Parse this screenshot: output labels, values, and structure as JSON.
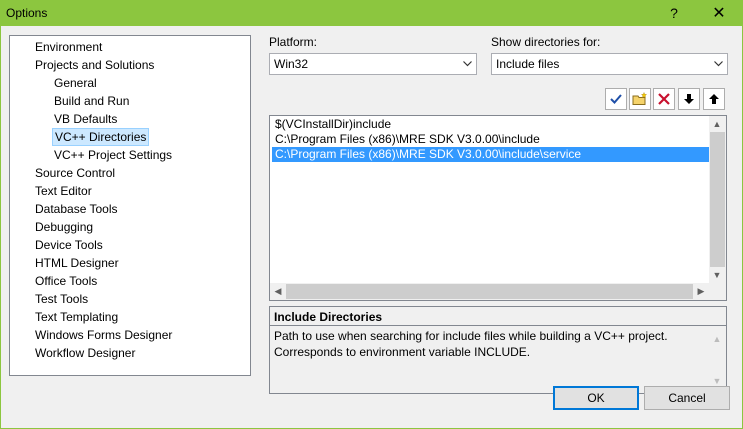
{
  "window": {
    "title": "Options",
    "help_glyph": "?",
    "close_glyph": "✕"
  },
  "tree": {
    "items": [
      {
        "label": "Environment",
        "indent": 0
      },
      {
        "label": "Projects and Solutions",
        "indent": 0
      },
      {
        "label": "General",
        "indent": 1
      },
      {
        "label": "Build and Run",
        "indent": 1
      },
      {
        "label": "VB Defaults",
        "indent": 1
      },
      {
        "label": "VC++ Directories",
        "indent": 1,
        "selected": true
      },
      {
        "label": "VC++ Project Settings",
        "indent": 1
      },
      {
        "label": "Source Control",
        "indent": 0
      },
      {
        "label": "Text Editor",
        "indent": 0
      },
      {
        "label": "Database Tools",
        "indent": 0
      },
      {
        "label": "Debugging",
        "indent": 0
      },
      {
        "label": "Device Tools",
        "indent": 0
      },
      {
        "label": "HTML Designer",
        "indent": 0
      },
      {
        "label": "Office Tools",
        "indent": 0
      },
      {
        "label": "Test Tools",
        "indent": 0
      },
      {
        "label": "Text Templating",
        "indent": 0
      },
      {
        "label": "Windows Forms Designer",
        "indent": 0
      },
      {
        "label": "Workflow Designer",
        "indent": 0
      }
    ]
  },
  "platform": {
    "label": "Platform:",
    "value": "Win32"
  },
  "show_dirs": {
    "label": "Show directories for:",
    "value": "Include files"
  },
  "toolbar": {
    "check_icon": "check-icon",
    "new_folder_icon": "new-folder-icon",
    "delete_icon": "delete-icon",
    "move_down_icon": "arrow-down-icon",
    "move_up_icon": "arrow-up-icon"
  },
  "directories": [
    {
      "path": "$(VCInstallDir)include"
    },
    {
      "path": "C:\\Program Files (x86)\\MRE SDK V3.0.00\\include"
    },
    {
      "path": "C:\\Program Files (x86)\\MRE SDK V3.0.00\\include\\service",
      "selected": true
    }
  ],
  "description": {
    "title": "Include Directories",
    "text": "Path to use when searching for include files while building a VC++ project. Corresponds to environment variable INCLUDE."
  },
  "buttons": {
    "ok": "OK",
    "cancel": "Cancel"
  },
  "colors": {
    "titlebar": "#8cc63f",
    "selection": "#3399ff",
    "tree_selection": "#cce8ff"
  }
}
